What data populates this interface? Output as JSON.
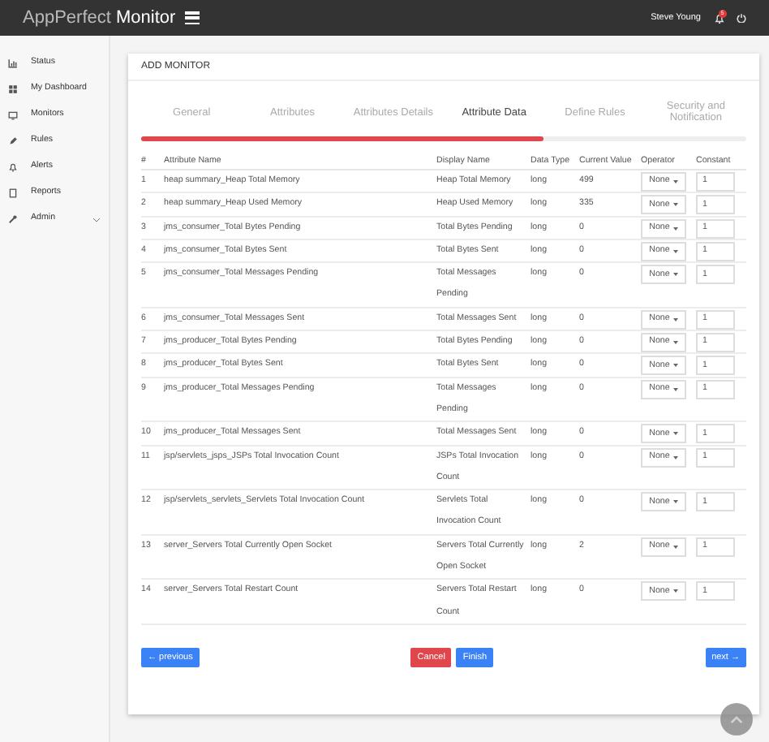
{
  "header": {
    "brand_light": "AppPerfect",
    "brand_bold": "Monitor",
    "user": "Steve Young",
    "notification_count": "5"
  },
  "sidebar": {
    "items": [
      {
        "label": "Status"
      },
      {
        "label": "My Dashboard"
      },
      {
        "label": "Monitors"
      },
      {
        "label": "Rules"
      },
      {
        "label": "Alerts"
      },
      {
        "label": "Reports"
      },
      {
        "label": "Admin",
        "expandable": true
      }
    ]
  },
  "card": {
    "title": "ADD MONITOR",
    "steps": [
      {
        "label": "General",
        "selected": false
      },
      {
        "label": "Attributes",
        "selected": false
      },
      {
        "label": "Attributes Details",
        "selected": false
      },
      {
        "label": "Attribute Data",
        "selected": true
      },
      {
        "label": "Define Rules",
        "selected": false
      },
      {
        "label": "Security and Notification",
        "selected": false
      }
    ],
    "progress": {
      "level": 0.665
    },
    "table": {
      "columns": [
        "#",
        "Attribute Name",
        "Display Name",
        "Data Type",
        "Current Value",
        "Operator",
        "Constant"
      ],
      "rows": [
        {
          "n": "1",
          "attribute": "heap summary_Heap Total Memory",
          "display": "Heap Total Memory",
          "type": "long",
          "value": "499",
          "operator": "None",
          "constant": "1"
        },
        {
          "n": "2",
          "attribute": "heap summary_Heap Used Memory",
          "display": "Heap Used Memory",
          "type": "long",
          "value": "335",
          "operator": "None",
          "constant": "1"
        },
        {
          "n": "3",
          "attribute": "jms_consumer_Total Bytes Pending",
          "display": "Total Bytes Pending",
          "type": "long",
          "value": "0",
          "operator": "None",
          "constant": "1"
        },
        {
          "n": "4",
          "attribute": "jms_consumer_Total Bytes Sent",
          "display": "Total Bytes Sent",
          "type": "long",
          "value": "0",
          "operator": "None",
          "constant": "1"
        },
        {
          "n": "5",
          "attribute": "jms_consumer_Total Messages Pending",
          "display": "Total Messages Pending",
          "type": "long",
          "value": "0",
          "operator": "None",
          "constant": "1"
        },
        {
          "n": "6",
          "attribute": "jms_consumer_Total Messages Sent",
          "display": "Total Messages Sent",
          "type": "long",
          "value": "0",
          "operator": "None",
          "constant": "1"
        },
        {
          "n": "7",
          "attribute": "jms_producer_Total Bytes Pending",
          "display": "Total Bytes Pending",
          "type": "long",
          "value": "0",
          "operator": "None",
          "constant": "1"
        },
        {
          "n": "8",
          "attribute": "jms_producer_Total Bytes Sent",
          "display": "Total Bytes Sent",
          "type": "long",
          "value": "0",
          "operator": "None",
          "constant": "1"
        },
        {
          "n": "9",
          "attribute": "jms_producer_Total Messages Pending",
          "display": "Total Messages Pending",
          "type": "long",
          "value": "0",
          "operator": "None",
          "constant": "1"
        },
        {
          "n": "10",
          "attribute": "jms_producer_Total Messages Sent",
          "display": "Total Messages Sent",
          "type": "long",
          "value": "0",
          "operator": "None",
          "constant": "1"
        },
        {
          "n": "11",
          "attribute": "jsp/servlets_jsps_JSPs Total Invocation Count",
          "display": "JSPs Total Invocation Count",
          "type": "long",
          "value": "0",
          "operator": "None",
          "constant": "1"
        },
        {
          "n": "12",
          "attribute": "jsp/servlets_servlets_Servlets Total Invocation Count",
          "display": "Servlets Total Invocation Count",
          "type": "long",
          "value": "0",
          "operator": "None",
          "constant": "1"
        },
        {
          "n": "13",
          "attribute": "server_Servers Total Currently Open Socket",
          "display": "Servers Total Currently Open Socket",
          "type": "long",
          "value": "2",
          "operator": "None",
          "constant": "1"
        },
        {
          "n": "14",
          "attribute": "server_Servers Total Restart Count",
          "display": "Servers Total Restart Count",
          "type": "long",
          "value": "0",
          "operator": "None",
          "constant": "1"
        }
      ]
    },
    "buttons": {
      "previous": "← previous",
      "cancel": "Cancel",
      "finish": "Finish",
      "next": "next →"
    }
  }
}
